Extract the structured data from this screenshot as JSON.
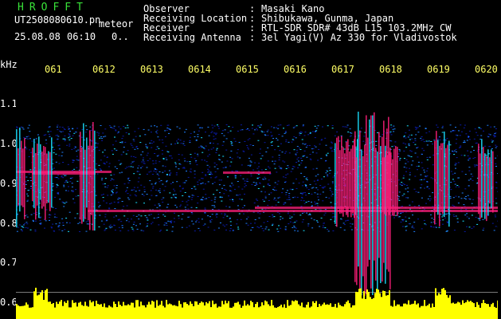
{
  "app": {
    "logo": "HROFFT",
    "filename": "UT2508080610.pn",
    "mode": "meteor",
    "date": "25.08.08",
    "time": "06:10",
    "counter": "0.."
  },
  "header": {
    "rows": [
      {
        "label": "Observer",
        "value": "Masaki Kano"
      },
      {
        "label": "Receiving Location",
        "value": "Shibukawa, Gunma, Japan"
      },
      {
        "label": "Receiver",
        "value": "RTL-SDR SDR# 43dB L15 103.2MHz CW"
      },
      {
        "label": "Receiving Antenna",
        "value": "3el Yagi(V) Az 330 for Vladivostok"
      }
    ]
  },
  "axis": {
    "unit": "kHz",
    "x_ticks": [
      "061",
      "0612",
      "0613",
      "0614",
      "0615",
      "0616",
      "0617",
      "0618",
      "0619",
      "0620"
    ],
    "y_ticks": [
      "1.1",
      "1.0",
      "0.9",
      "0.8",
      "0.7",
      "0.6"
    ]
  },
  "colors": {
    "background": "#000000",
    "logo": "#39e239",
    "tick": "#ffff66",
    "echo": "#ff1f7a",
    "noise_low": "#0a1aa8",
    "noise_mid": "#1f7fff",
    "noise_high": "#19e0ff",
    "power": "#ffff00"
  }
}
